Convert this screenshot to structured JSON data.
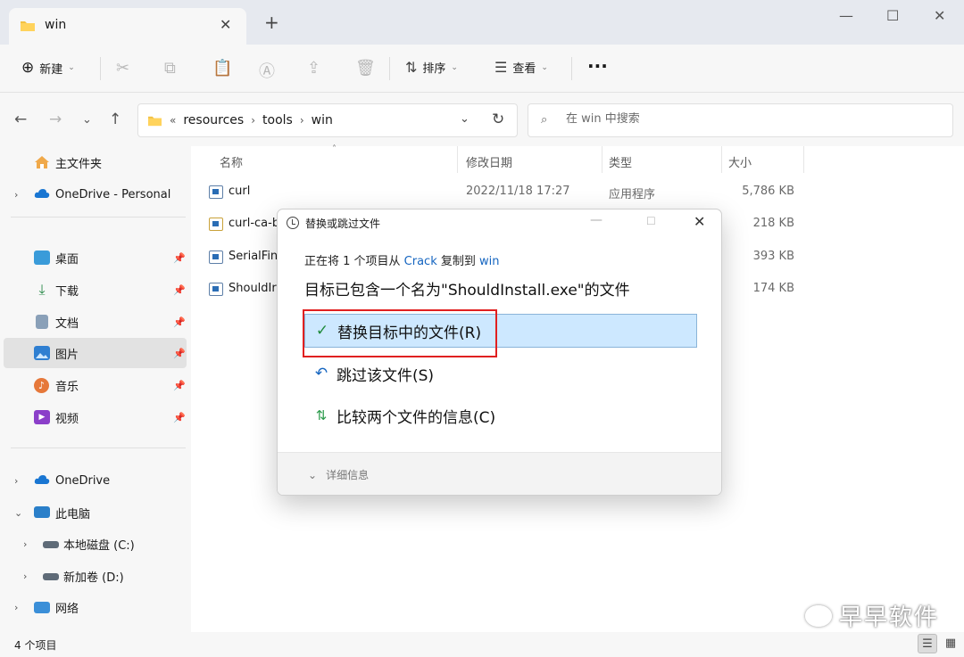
{
  "window": {
    "tab_title": "win",
    "tab_close": "✕",
    "new_tab": "+",
    "minimize": "—",
    "maximize": "☐",
    "close": "✕"
  },
  "toolbar": {
    "new_label": "新建",
    "sort_label": "排序",
    "view_label": "查看",
    "more": "···"
  },
  "address": {
    "overflow": "«",
    "crumbs": [
      "resources",
      "tools",
      "win"
    ],
    "search_placeholder": "在 win 中搜索"
  },
  "sidebar": {
    "items": [
      {
        "label": "主文件夹",
        "icon": "home-icon"
      },
      {
        "label": "OneDrive - Personal",
        "icon": "cloud-icon"
      },
      {
        "label": "桌面",
        "icon": "desktop-icon"
      },
      {
        "label": "下载",
        "icon": "download-icon"
      },
      {
        "label": "文档",
        "icon": "document-icon"
      },
      {
        "label": "图片",
        "icon": "pictures-icon"
      },
      {
        "label": "音乐",
        "icon": "music-icon"
      },
      {
        "label": "视频",
        "icon": "video-icon"
      },
      {
        "label": "OneDrive",
        "icon": "cloud-icon"
      },
      {
        "label": "此电脑",
        "icon": "computer-icon"
      },
      {
        "label": "本地磁盘 (C:)",
        "icon": "drive-icon"
      },
      {
        "label": "新加卷 (D:)",
        "icon": "drive-icon"
      },
      {
        "label": "网络",
        "icon": "network-icon"
      }
    ]
  },
  "columns": {
    "name": "名称",
    "date": "修改日期",
    "type": "类型",
    "size": "大小"
  },
  "files": [
    {
      "name": "curl",
      "date": "2022/11/18 17:27",
      "type": "应用程序",
      "size": "5,786 KB"
    },
    {
      "name": "curl-ca-b",
      "date": "",
      "type": "",
      "size": "218 KB"
    },
    {
      "name": "SerialFin",
      "date": "",
      "type": "",
      "size": "393 KB"
    },
    {
      "name": "ShouldIr",
      "date": "",
      "type": "",
      "size": "174 KB"
    }
  ],
  "status": {
    "count": "4 个项目"
  },
  "dialog": {
    "title": "替换或跳过文件",
    "line1_pre": "正在将 1 个项目从 ",
    "source": "Crack",
    "line1_mid": " 复制到 ",
    "dest": "win",
    "line2": "目标已包含一个名为\"ShouldInstall.exe\"的文件",
    "opt_replace": "替换目标中的文件(R)",
    "opt_skip": "跳过该文件(S)",
    "opt_compare": "比较两个文件的信息(C)",
    "details": "详细信息"
  },
  "watermark": {
    "text": "早早软件"
  },
  "colors": {
    "accent": "#1565c0",
    "selection": "#cde8ff",
    "highlight_box": "#e02020"
  }
}
